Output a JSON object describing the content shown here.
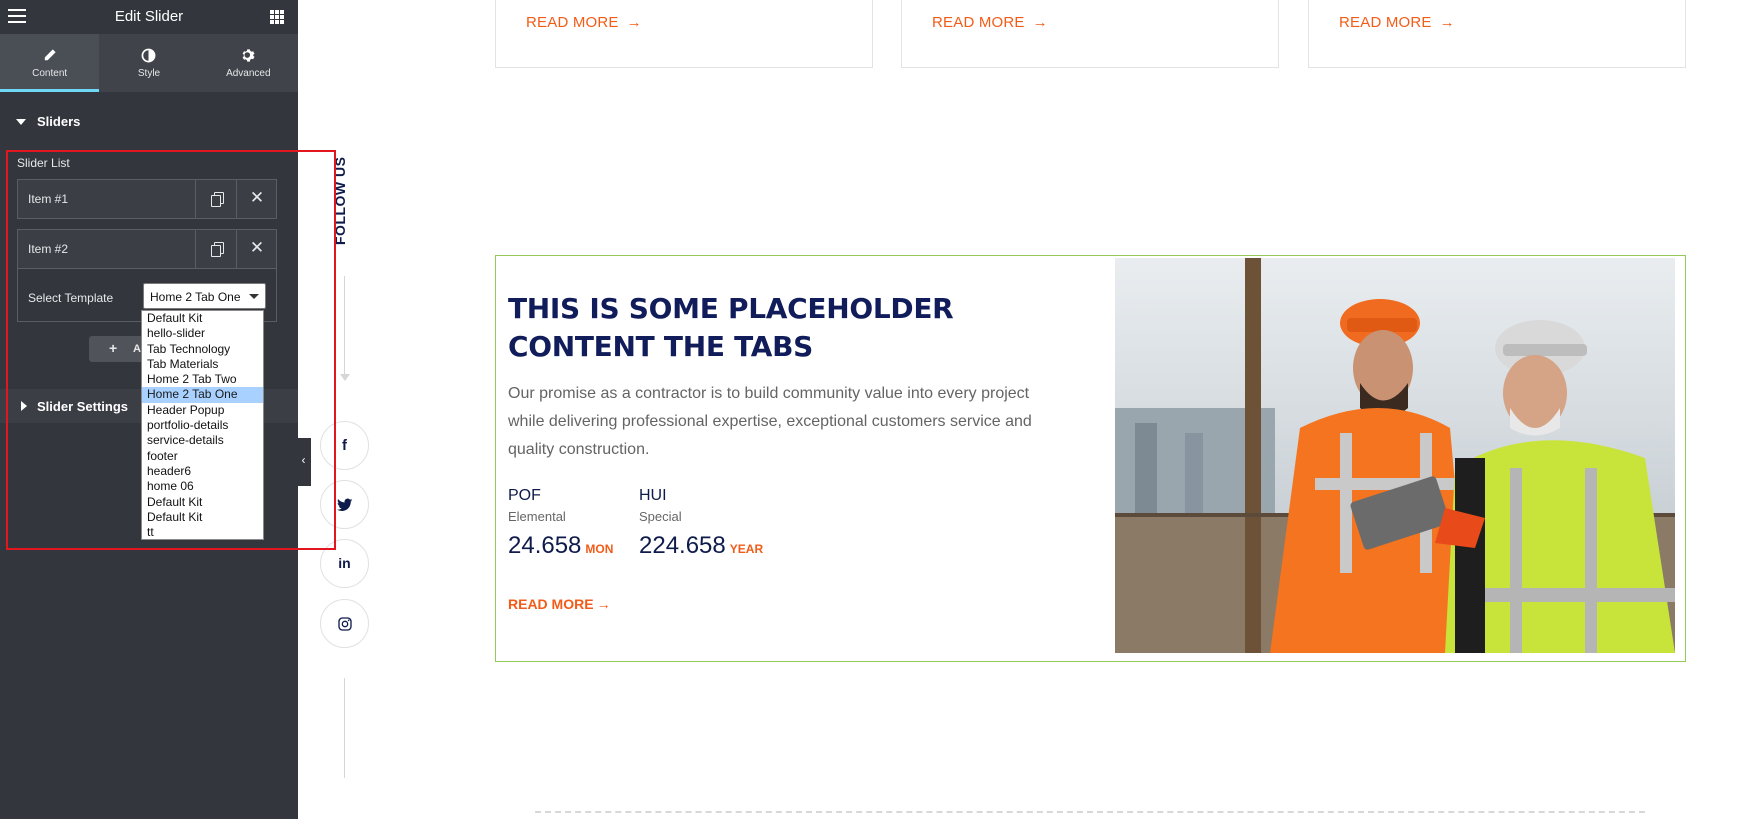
{
  "panel": {
    "title": "Edit Slider",
    "tabs": [
      {
        "label": "Content",
        "icon": "pencil-icon",
        "active": true
      },
      {
        "label": "Style",
        "icon": "contrast-icon",
        "active": false
      },
      {
        "label": "Advanced",
        "icon": "gear-icon",
        "active": false
      }
    ],
    "sections": {
      "sliders": "Sliders",
      "slider_settings": "Slider Settings"
    },
    "slider_list_label": "Slider List",
    "items": [
      {
        "title": "Item #1"
      },
      {
        "title": "Item #2"
      }
    ],
    "select_template_label": "Select Template",
    "select_value": "Home 2 Tab One",
    "add_item_label": "A",
    "template_options": [
      "Default Kit",
      "hello-slider",
      "Tab Technology",
      "Tab Materials",
      "Home 2 Tab Two",
      "Home 2 Tab One",
      "Header Popup",
      "portfolio-details",
      "service-details",
      "footer",
      "header6",
      "home 06",
      "Default Kit",
      "Default Kit",
      "tt"
    ],
    "selected_option_index": 5
  },
  "page": {
    "cards": [
      {
        "read_more": "READ MORE"
      },
      {
        "read_more": "READ MORE"
      },
      {
        "read_more": "READ MORE"
      }
    ],
    "follow_us": "FOLLOW US",
    "social_icons": [
      "facebook-icon",
      "twitter-icon",
      "linkedin-icon",
      "instagram-icon"
    ],
    "feature": {
      "title": "THIS IS SOME PLACEHOLDER CONTENT THE TABS",
      "description": "Our promise as a contractor is to build community value into every project while delivering professional expertise, exceptional customers service and quality construction.",
      "stats": [
        {
          "code": "POF",
          "sub": "Elemental",
          "value": "24.658",
          "unit": "MON"
        },
        {
          "code": "HUI",
          "sub": "Special",
          "value": "224.658",
          "unit": "YEAR"
        }
      ],
      "read_more": "READ MORE"
    }
  },
  "colors": {
    "panel_bg": "#33373d",
    "accent_tab": "#71d7f7",
    "highlight_border": "#e2161f",
    "brand_orange": "#f25c19",
    "brand_navy": "#111c5a",
    "feature_border": "#94c95a"
  }
}
